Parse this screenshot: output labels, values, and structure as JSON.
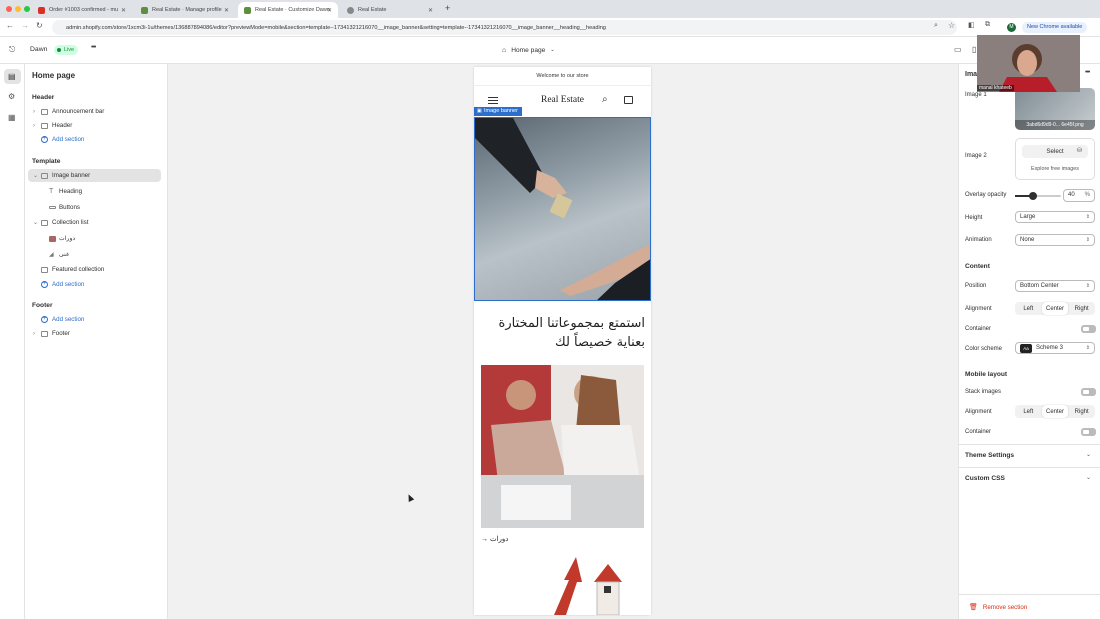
{
  "browser": {
    "tabs": [
      {
        "title": "Order #1003 confirmed - mu",
        "active": false,
        "icon": "gmail-icon"
      },
      {
        "title": "Real Estate · Manage profile",
        "active": false,
        "icon": "shopify-icon"
      },
      {
        "title": "Real Estate · Customize Dawn",
        "active": true,
        "icon": "shopify-icon"
      },
      {
        "title": "Real Estate",
        "active": false,
        "icon": "globe-icon"
      }
    ],
    "new_tab": "+",
    "url": "admin.shopify.com/store/1xcm3i-1u/themes/136887894086/editor?previewMode=mobile&section=template--17341321216070__image_banner&setting=template--17341321216070__image_banner__heading__heading",
    "chrome_badge": "New Chrome available",
    "profile_initial": "M"
  },
  "editor": {
    "theme_name": "Dawn",
    "status": "Live",
    "more": "•••",
    "page_selector": "Home page"
  },
  "sidebar": {
    "title": "Home page",
    "header_group": "Header",
    "header_items": [
      "Announcement bar",
      "Header"
    ],
    "add_section": "Add section",
    "template_group": "Template",
    "template_items": [
      {
        "label": "Image banner",
        "level": 0,
        "selected": true
      },
      {
        "label": "Heading",
        "level": 1
      },
      {
        "label": "Buttons",
        "level": 1
      },
      {
        "label": "Collection list",
        "level": 0
      },
      {
        "label": "دورات",
        "level": 1
      },
      {
        "label": "غنى",
        "level": 1
      },
      {
        "label": "Featured collection",
        "level": 0
      }
    ],
    "footer_group": "Footer",
    "footer_items": [
      "Footer"
    ]
  },
  "preview": {
    "announcement": "Welcome to our store",
    "store_name": "Real Estate",
    "section_badge": "Image banner",
    "heading_ar": "استمتع بمجموعاتنا المختارة بعناية خصيصاً لك",
    "collection_link": "دورات →"
  },
  "panel": {
    "section_title": "Image",
    "image1_label": "Image 1",
    "image1_filename": "3abd6d9d9-0... 6e45f.png",
    "image2_label": "Image 2",
    "select_button": "Select",
    "explore_link": "Explore free images",
    "overlay_label": "Overlay opacity",
    "overlay_value": "40",
    "overlay_unit": "%",
    "overlay_fraction": 0.4,
    "height_label": "Height",
    "height_value": "Large",
    "animation_label": "Animation",
    "animation_value": "None",
    "content_heading": "Content",
    "position_label": "Position",
    "position_value": "Bottom Center",
    "alignment_label": "Alignment",
    "alignment_options": [
      "Left",
      "Center",
      "Right"
    ],
    "alignment_selected": "Center",
    "container_label": "Container",
    "color_scheme_label": "Color scheme",
    "color_scheme_value": "Scheme 3",
    "color_scheme_swatch": "Aa",
    "mobile_heading": "Mobile layout",
    "stack_label": "Stack images",
    "mobile_alignment_label": "Alignment",
    "mobile_alignment_selected": "Center",
    "mobile_container_label": "Container",
    "theme_settings": "Theme Settings",
    "custom_css": "Custom CSS",
    "remove_section": "Remove section"
  },
  "webcam": {
    "name": "manal khateeb"
  },
  "colors": {
    "accent": "#2c6ecb",
    "live_badge": "#1a8a3a",
    "remove": "#d72c0d"
  }
}
